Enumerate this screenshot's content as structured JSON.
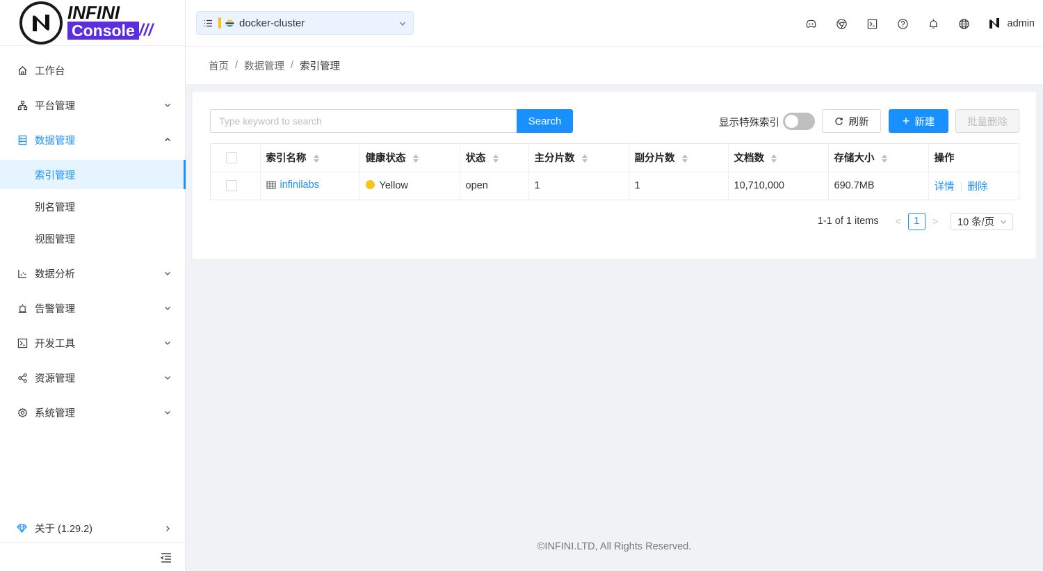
{
  "brand": {
    "line1": "INFINI",
    "line2": "Console",
    "slashes": "///"
  },
  "sidebar": {
    "items": [
      {
        "label": "工作台",
        "icon": "home-icon"
      },
      {
        "label": "平台管理",
        "icon": "cluster-icon"
      },
      {
        "label": "数据管理",
        "icon": "database-icon"
      },
      {
        "label": "数据分析",
        "icon": "chart-icon"
      },
      {
        "label": "告警管理",
        "icon": "alarm-icon"
      },
      {
        "label": "开发工具",
        "icon": "terminal-icon"
      },
      {
        "label": "资源管理",
        "icon": "share-icon"
      },
      {
        "label": "系统管理",
        "icon": "settings-icon"
      }
    ],
    "data_sub": [
      "索引管理",
      "别名管理",
      "视图管理"
    ],
    "about": "关于 (1.29.2)"
  },
  "header": {
    "cluster": "docker-cluster",
    "user": "admin"
  },
  "breadcrumb": {
    "home": "首页",
    "parent": "数据管理",
    "current": "索引管理",
    "sep": "/"
  },
  "toolbar": {
    "search_placeholder": "Type keyword to search",
    "search_label": "Search",
    "special_index_label": "显示特殊索引",
    "special_index_on": false,
    "refresh_label": "刷新",
    "new_label": "新建",
    "bulk_delete_label": "批量删除"
  },
  "table": {
    "columns": [
      "索引名称",
      "健康状态",
      "状态",
      "主分片数",
      "副分片数",
      "文档数",
      "存储大小",
      "操作"
    ],
    "rows": [
      {
        "name": "infinilabs",
        "health": "Yellow",
        "status": "open",
        "primaries": "1",
        "replicas": "1",
        "docs": "10,710,000",
        "size": "690.7MB",
        "op_detail": "详情",
        "op_delete": "删除"
      }
    ]
  },
  "pagination": {
    "total_text": "1-1 of 1 items",
    "current_page": "1",
    "page_size": "10 条/页"
  },
  "footer": "©INFINI.LTD, All Rights Reserved.",
  "colors": {
    "primary": "#1890ff",
    "brand_purple": "#5b2ee0",
    "health_yellow": "#f5c518"
  }
}
